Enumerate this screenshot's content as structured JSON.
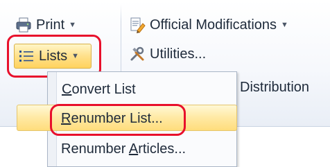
{
  "ribbon": {
    "print_button": {
      "label": "Print",
      "icon": "printer-icon"
    },
    "lists_button": {
      "label": "Lists",
      "icon": "list-icon"
    },
    "official_modifications_button": {
      "label": "Official Modifications",
      "icon": "document-edit-icon"
    },
    "utilities_button": {
      "label": "Utilities...",
      "icon": "tools-icon"
    },
    "distribution_label": "Distribution"
  },
  "lists_menu": {
    "items": [
      {
        "prefix": "",
        "underlined": "C",
        "suffix": "onvert List"
      },
      {
        "prefix": "",
        "underlined": "R",
        "suffix": "enumber List..."
      },
      {
        "prefix": "Renumber ",
        "underlined": "A",
        "suffix": "rticles..."
      }
    ],
    "highlighted_item": "Renumber List..."
  },
  "colors": {
    "highlight_ring": "#e8102c",
    "hover_fill": "#ffe08a",
    "ribbon_bg": "#f6f8fc"
  }
}
